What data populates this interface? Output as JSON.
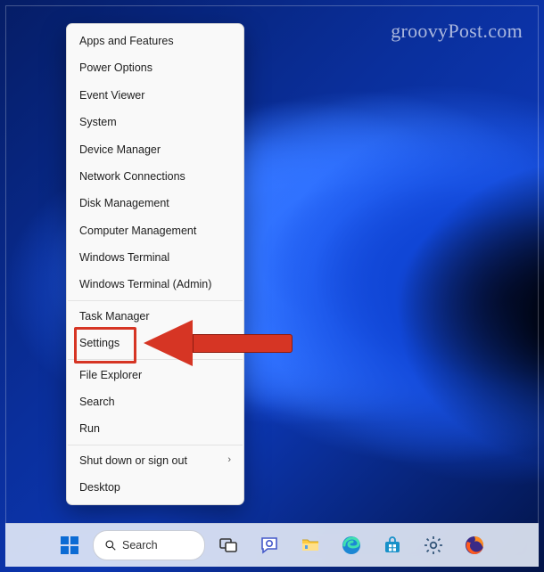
{
  "watermark": "groovyPost.com",
  "menu": {
    "groups": [
      [
        "Apps and Features",
        "Power Options",
        "Event Viewer",
        "System",
        "Device Manager",
        "Network Connections",
        "Disk Management",
        "Computer Management",
        "Windows Terminal",
        "Windows Terminal (Admin)"
      ],
      [
        "Task Manager",
        "Settings"
      ],
      [
        "File Explorer",
        "Search",
        "Run"
      ],
      [
        {
          "label": "Shut down or sign out",
          "submenu": true
        },
        "Desktop"
      ]
    ],
    "highlight": "Settings"
  },
  "taskbar": {
    "search_label": "Search",
    "items": [
      "start",
      "search",
      "task-view",
      "chat",
      "file-explorer",
      "edge",
      "store",
      "settings",
      "firefox"
    ]
  },
  "annotation": {
    "highlight_color": "#d63524",
    "arrow_color": "#d63524"
  }
}
